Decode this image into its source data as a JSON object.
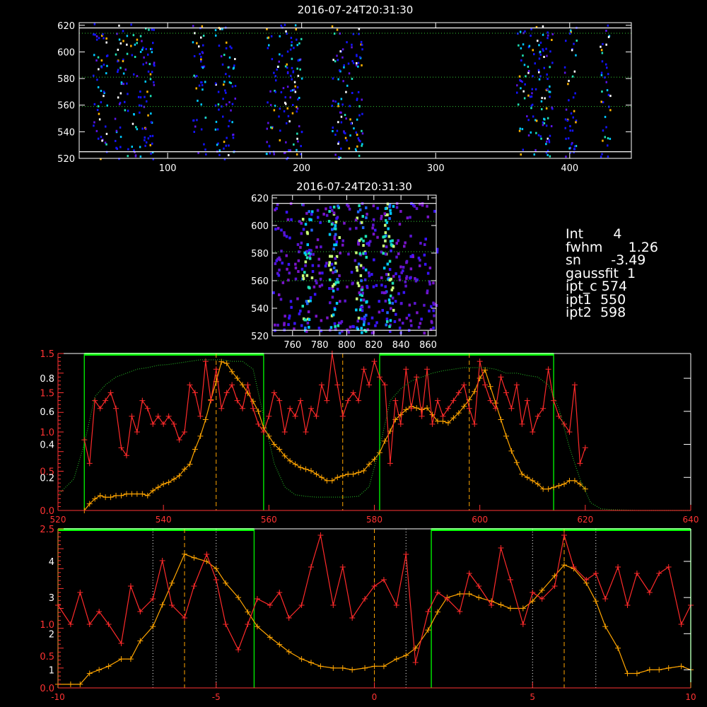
{
  "chart_data": [
    {
      "type": "heatmap",
      "title": "2016-07-24T20:31:30",
      "xlim": [
        34,
        446
      ],
      "ylim": [
        520,
        622
      ],
      "xticks": [
        100,
        200,
        300,
        400
      ],
      "yticks": [
        520,
        540,
        560,
        580,
        600,
        620
      ],
      "white_hlines": [
        618,
        525
      ],
      "dotted_hlines": [
        614,
        581,
        559
      ],
      "colormap": [
        "#1414ff",
        "#5a14e6",
        "#00c8ff",
        "#1ee0b4",
        "#ffb400",
        "#ffffff"
      ],
      "column_bands": [
        [
          44,
          55
        ],
        [
          60,
          70
        ],
        [
          72,
          90
        ],
        [
          118,
          128
        ],
        [
          135,
          150
        ],
        [
          173,
          200
        ],
        [
          222,
          245
        ],
        [
          360,
          387
        ],
        [
          395,
          405
        ],
        [
          422,
          430
        ]
      ]
    },
    {
      "type": "heatmap",
      "title": "2016-07-24T20:31:30",
      "xlim": [
        745,
        866
      ],
      "ylim": [
        520,
        622
      ],
      "xticks": [
        760,
        780,
        800,
        820,
        840,
        860
      ],
      "yticks": [
        520,
        540,
        560,
        580,
        600,
        620
      ],
      "white_hlines": [
        616,
        524
      ],
      "dotted_hlines": [
        603,
        581,
        560
      ]
    },
    {
      "type": "line",
      "xlim": [
        520,
        640
      ],
      "xticks": [
        520,
        540,
        560,
        580,
        600,
        620,
        640
      ],
      "left_axis_1_ticks": [
        {
          "v": 0.0,
          "l": "0.0"
        },
        {
          "v": 0.5,
          "l": "0.5"
        },
        {
          "v": 1.0,
          "l": "1.0"
        },
        {
          "v": 1.5,
          "l": "1.5"
        },
        {
          "v": 2.0,
          "l": "1.5"
        }
      ],
      "left_axis_1_range": [
        0,
        2.0
      ],
      "left_axis_2_ticks": [
        0.2,
        0.4,
        0.6,
        0.8
      ],
      "left_axis_2_range": [
        0,
        0.95
      ],
      "vlines_dashed": [
        550,
        574,
        598
      ],
      "green_boxes": [
        [
          525,
          559
        ],
        [
          581,
          614
        ]
      ],
      "series": [
        {
          "color": "#ffa500",
          "x": [
            525,
            526,
            527,
            528,
            529,
            530,
            531,
            532,
            533,
            534,
            535,
            536,
            537,
            538,
            539,
            540,
            541,
            542,
            543,
            544,
            545,
            546,
            547,
            548,
            549,
            550,
            551,
            552,
            553,
            554,
            555,
            556,
            557,
            558,
            559,
            560,
            561,
            562,
            563,
            564,
            565,
            566,
            567,
            568,
            569,
            570,
            571,
            572,
            573,
            574,
            575,
            576,
            577,
            578,
            579,
            580,
            581,
            582,
            583,
            584,
            585,
            586,
            587,
            588,
            589,
            590,
            591,
            592,
            593,
            594,
            595,
            596,
            597,
            598,
            599,
            600,
            601,
            602,
            603,
            604,
            605,
            606,
            607,
            608,
            609,
            610,
            611,
            612,
            613,
            614,
            615,
            616,
            617,
            618,
            619,
            620
          ],
          "y": [
            0.0,
            0.04,
            0.07,
            0.09,
            0.08,
            0.08,
            0.09,
            0.09,
            0.1,
            0.1,
            0.1,
            0.1,
            0.09,
            0.12,
            0.14,
            0.16,
            0.17,
            0.19,
            0.21,
            0.25,
            0.28,
            0.37,
            0.45,
            0.55,
            0.67,
            0.78,
            0.9,
            0.89,
            0.84,
            0.8,
            0.76,
            0.71,
            0.66,
            0.6,
            0.5,
            0.45,
            0.4,
            0.37,
            0.33,
            0.3,
            0.28,
            0.26,
            0.25,
            0.24,
            0.22,
            0.2,
            0.18,
            0.18,
            0.2,
            0.21,
            0.22,
            0.22,
            0.23,
            0.24,
            0.28,
            0.31,
            0.35,
            0.42,
            0.48,
            0.55,
            0.58,
            0.61,
            0.63,
            0.62,
            0.61,
            0.62,
            0.58,
            0.54,
            0.54,
            0.53,
            0.56,
            0.59,
            0.63,
            0.67,
            0.72,
            0.8,
            0.85,
            0.75,
            0.65,
            0.55,
            0.45,
            0.36,
            0.29,
            0.22,
            0.2,
            0.18,
            0.16,
            0.13,
            0.13,
            0.14,
            0.15,
            0.16,
            0.18,
            0.18,
            0.16,
            0.13
          ]
        },
        {
          "color": "#ff2a2a",
          "x": [
            525,
            526,
            527,
            528,
            529,
            530,
            531,
            532,
            533,
            534,
            535,
            536,
            537,
            538,
            539,
            540,
            541,
            542,
            543,
            544,
            545,
            546,
            547,
            548,
            549,
            550,
            551,
            552,
            553,
            554,
            555,
            556,
            557,
            558,
            559,
            560,
            561,
            562,
            563,
            564,
            565,
            566,
            567,
            568,
            569,
            570,
            571,
            572,
            573,
            574,
            575,
            576,
            577,
            578,
            579,
            580,
            581,
            582,
            583,
            584,
            585,
            586,
            587,
            588,
            589,
            590,
            591,
            592,
            593,
            594,
            595,
            596,
            597,
            598,
            599,
            600,
            601,
            602,
            603,
            604,
            605,
            606,
            607,
            608,
            609,
            610,
            611,
            612,
            613,
            614,
            615,
            616,
            617,
            618,
            619,
            620
          ],
          "y": [
            0.9,
            0.6,
            1.4,
            1.3,
            1.4,
            1.5,
            1.3,
            0.8,
            0.7,
            1.2,
            1.0,
            1.4,
            1.3,
            1.1,
            1.2,
            1.1,
            1.2,
            1.1,
            0.9,
            1.0,
            1.6,
            1.5,
            1.2,
            1.9,
            1.4,
            1.8,
            1.3,
            1.5,
            1.6,
            1.4,
            1.3,
            1.6,
            1.3,
            1.1,
            1.0,
            1.2,
            1.5,
            1.4,
            1.0,
            1.3,
            1.2,
            1.4,
            1.0,
            1.3,
            1.2,
            1.6,
            1.4,
            2.0,
            1.6,
            1.2,
            1.4,
            1.5,
            1.4,
            1.8,
            1.6,
            1.9,
            1.7,
            1.6,
            0.6,
            1.4,
            1.1,
            1.8,
            1.3,
            1.7,
            1.2,
            1.8,
            1.1,
            1.4,
            1.2,
            1.3,
            1.4,
            1.5,
            1.6,
            1.3,
            1.1,
            1.9,
            1.6,
            1.4,
            1.3,
            1.7,
            1.5,
            1.3,
            1.6,
            1.1,
            1.4,
            1.0,
            1.2,
            1.3,
            1.8,
            1.4,
            1.2,
            1.1,
            1.0,
            1.6,
            0.6,
            0.8
          ]
        },
        {
          "color": "#22aa22",
          "dotted": true,
          "x": [
            520,
            523,
            525,
            527,
            529,
            531,
            533,
            535,
            537,
            539,
            541,
            543,
            545,
            547,
            549,
            551,
            553,
            555,
            557,
            559,
            561,
            563,
            565,
            567,
            569,
            571,
            573,
            575,
            577,
            579,
            581,
            583,
            585,
            587,
            589,
            591,
            593,
            595,
            597,
            599,
            601,
            603,
            605,
            607,
            609,
            611,
            613,
            615,
            617,
            619,
            621,
            623,
            625,
            630,
            635,
            640
          ],
          "y": [
            0.2,
            0.4,
            0.85,
            1.45,
            1.6,
            1.7,
            1.75,
            1.8,
            1.82,
            1.85,
            1.86,
            1.88,
            1.9,
            1.92,
            1.92,
            1.92,
            1.9,
            1.9,
            1.8,
            1.2,
            0.6,
            0.3,
            0.2,
            0.18,
            0.17,
            0.17,
            0.17,
            0.17,
            0.18,
            0.3,
            0.8,
            1.4,
            1.55,
            1.65,
            1.7,
            1.75,
            1.78,
            1.8,
            1.82,
            1.82,
            1.82,
            1.8,
            1.75,
            1.75,
            1.72,
            1.7,
            1.6,
            1.3,
            0.8,
            0.4,
            0.1,
            0.02,
            0.01,
            0.0,
            0.0,
            0.0
          ]
        }
      ]
    },
    {
      "type": "line",
      "xlim": [
        -10,
        10
      ],
      "xticks": [
        -10,
        -5,
        0,
        5,
        10
      ],
      "left_axis_1_ticks": [
        {
          "v": 0.0,
          "l": "0.0"
        },
        {
          "v": 0.5,
          "l": "0.5"
        },
        {
          "v": 1.0,
          "l": "1.0"
        },
        {
          "v": 2.5,
          "l": "2.5"
        }
      ],
      "left_axis_1_range": [
        0,
        2.5
      ],
      "left_axis_2_ticks": [
        1,
        2,
        3,
        4
      ],
      "left_axis_2_range": [
        0.5,
        4.9
      ],
      "vlines_dashed": [
        -6,
        0,
        6
      ],
      "vlines_dotted": [
        -7,
        -5,
        1,
        5,
        7
      ],
      "green_boxes": [
        [
          -10,
          -3.8
        ],
        [
          1.8,
          10
        ]
      ],
      "series": [
        {
          "color": "#ffa500",
          "x": [
            -10,
            -9.6,
            -9.3,
            -9,
            -8.7,
            -8.4,
            -8,
            -7.7,
            -7.4,
            -7,
            -6.7,
            -6.4,
            -6,
            -5.7,
            -5.3,
            -5,
            -4.7,
            -4.3,
            -4,
            -3.7,
            -3.3,
            -3,
            -2.7,
            -2.3,
            -2,
            -1.7,
            -1.3,
            -1,
            -0.7,
            -0.3,
            0,
            0.3,
            0.7,
            1,
            1.3,
            1.7,
            2,
            2.3,
            2.7,
            3,
            3.3,
            3.7,
            4,
            4.3,
            4.7,
            5,
            5.3,
            5.7,
            6,
            6.3,
            6.7,
            7,
            7.3,
            7.7,
            8,
            8.3,
            8.7,
            9,
            9.3,
            9.7,
            10
          ],
          "y": [
            0.6,
            0.6,
            0.6,
            0.9,
            1.0,
            1.1,
            1.3,
            1.3,
            1.8,
            2.2,
            2.8,
            3.4,
            4.2,
            4.1,
            4.0,
            3.8,
            3.4,
            3.0,
            2.6,
            2.2,
            1.9,
            1.7,
            1.5,
            1.3,
            1.2,
            1.1,
            1.05,
            1.05,
            1.0,
            1.05,
            1.1,
            1.1,
            1.3,
            1.4,
            1.6,
            2.1,
            2.6,
            3.0,
            3.1,
            3.1,
            3.0,
            2.9,
            2.8,
            2.7,
            2.7,
            2.9,
            3.2,
            3.6,
            3.9,
            3.8,
            3.4,
            2.9,
            2.2,
            1.6,
            0.9,
            0.9,
            1.0,
            1.0,
            1.05,
            1.1,
            1.0
          ],
          "ax": 2
        },
        {
          "color": "#ff2a2a",
          "x": [
            -10,
            -9.6,
            -9.3,
            -9,
            -8.7,
            -8.4,
            -8,
            -7.7,
            -7.4,
            -7,
            -6.7,
            -6.4,
            -6,
            -5.7,
            -5.3,
            -5,
            -4.7,
            -4.3,
            -4,
            -3.7,
            -3.3,
            -3,
            -2.7,
            -2.3,
            -2,
            -1.7,
            -1.3,
            -1,
            -0.7,
            -0.3,
            0,
            0.3,
            0.7,
            1,
            1.3,
            1.7,
            2,
            2.3,
            2.7,
            3,
            3.3,
            3.7,
            4,
            4.3,
            4.7,
            5,
            5.3,
            5.7,
            6,
            6.3,
            6.7,
            7,
            7.3,
            7.7,
            8,
            8.3,
            8.7,
            9,
            9.3,
            9.7,
            10
          ],
          "y": [
            1.3,
            1.0,
            1.5,
            1.0,
            1.2,
            1.0,
            0.7,
            1.6,
            1.2,
            1.4,
            2.0,
            1.3,
            1.1,
            1.6,
            2.1,
            1.7,
            1.0,
            0.6,
            1.0,
            1.4,
            1.3,
            1.5,
            1.1,
            1.3,
            1.9,
            2.4,
            1.3,
            1.9,
            1.1,
            1.4,
            1.6,
            1.7,
            1.3,
            2.1,
            0.4,
            1.2,
            1.5,
            1.4,
            1.2,
            1.8,
            1.6,
            1.3,
            2.2,
            1.7,
            1.0,
            1.5,
            1.4,
            1.6,
            2.4,
            1.9,
            1.7,
            1.8,
            1.4,
            1.9,
            1.3,
            1.8,
            1.5,
            1.8,
            1.9,
            1.0,
            1.3
          ],
          "ax": 1
        }
      ]
    }
  ],
  "info": {
    "int": "Int       4",
    "fwhm": "fwhm      1.26",
    "sn": "sn       -3.49",
    "gaussfit": "gaussfit  1",
    "ipt_c": "ipt_c 574",
    "ipt1": "ipt1  550",
    "ipt2": "ipt2  598"
  }
}
